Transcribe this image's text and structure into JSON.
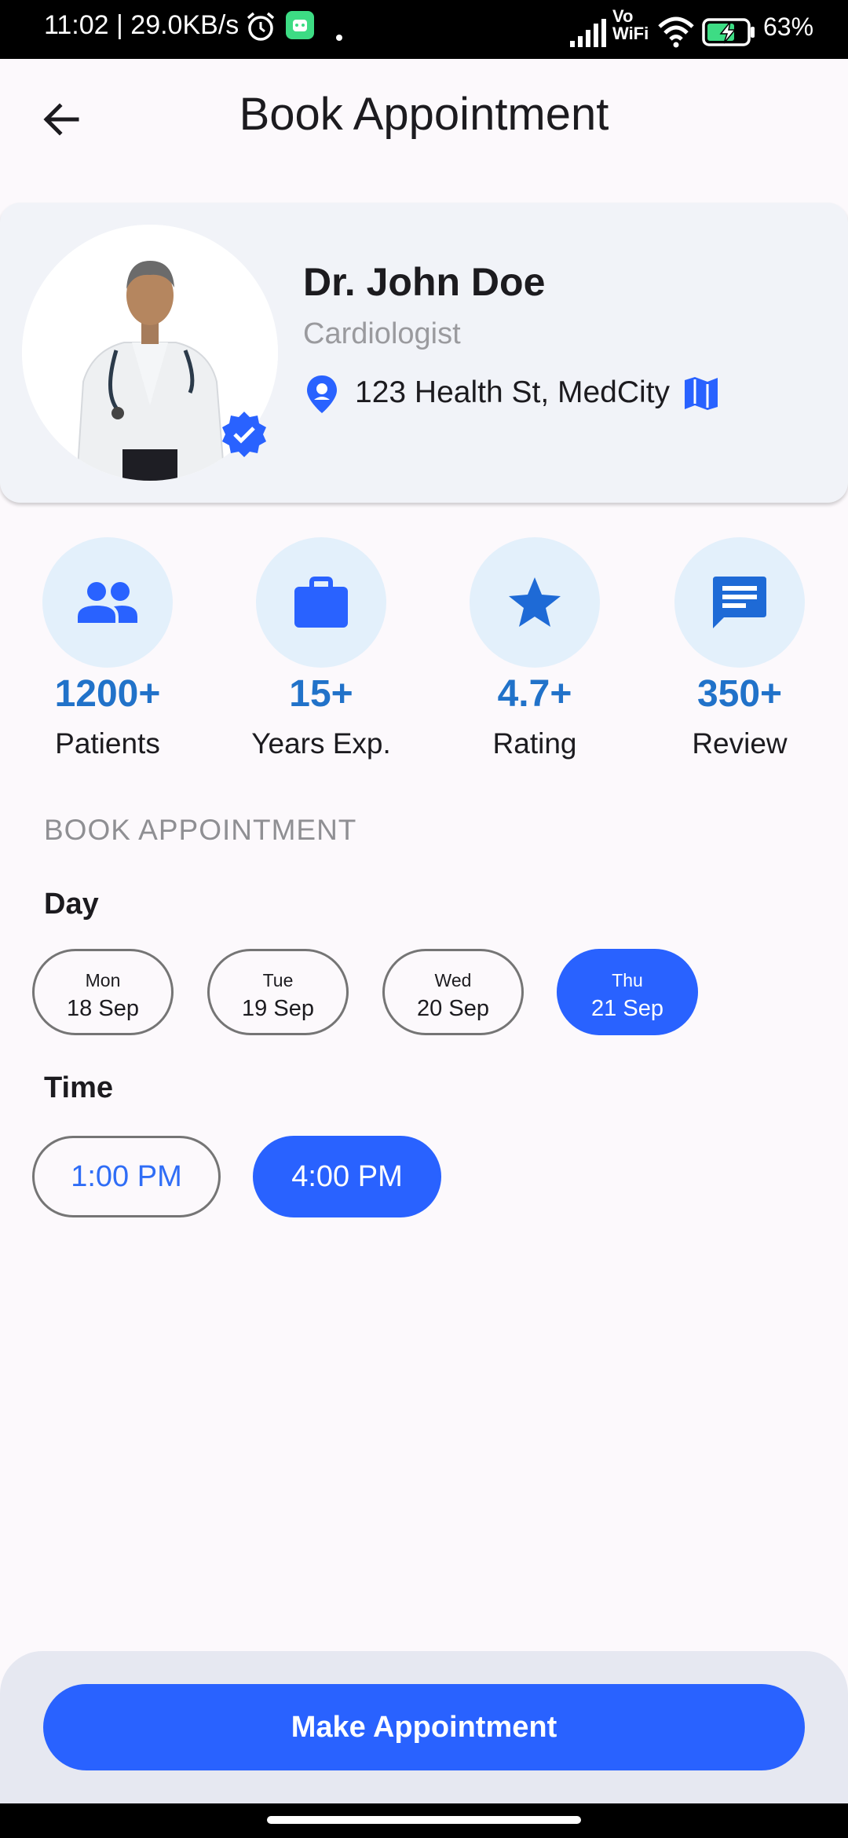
{
  "status_bar": {
    "time_speed": "11:02 | 29.0KB/s",
    "vowifi": "Vo WiFi",
    "battery": "63%",
    "icons": [
      "alarm-icon",
      "app-notification-icon",
      "signal-icon",
      "wifi-icon",
      "battery-charging-icon"
    ]
  },
  "app_bar": {
    "title": "Book Appointment",
    "back_icon": "arrow-back-icon"
  },
  "doctor": {
    "name": "Dr. John Doe",
    "specialty": "Cardiologist",
    "address": "123 Health St, MedCity",
    "verified_icon": "verified-badge-icon",
    "location_icon": "location-pin-icon",
    "map_icon": "map-icon"
  },
  "stats": [
    {
      "value": "1200+",
      "label": "Patients",
      "icon": "people-icon"
    },
    {
      "value": "15+",
      "label": "Years Exp.",
      "icon": "briefcase-icon"
    },
    {
      "value": "4.7+",
      "label": "Rating",
      "icon": "star-icon"
    },
    {
      "value": "350+",
      "label": "Review",
      "icon": "chat-icon"
    }
  ],
  "booking": {
    "section_title": "BOOK APPOINTMENT",
    "day_label": "Day",
    "time_label": "Time",
    "days": [
      {
        "name": "Mon",
        "date": "18 Sep",
        "selected": false
      },
      {
        "name": "Tue",
        "date": "19 Sep",
        "selected": false
      },
      {
        "name": "Wed",
        "date": "20 Sep",
        "selected": false
      },
      {
        "name": "Thu",
        "date": "21 Sep",
        "selected": true
      }
    ],
    "times": [
      {
        "label": "1:00 PM",
        "selected": false
      },
      {
        "label": "4:00 PM",
        "selected": true
      }
    ]
  },
  "cta": {
    "label": "Make Appointment"
  },
  "colors": {
    "primary": "#2962ff",
    "stat_value": "#2172c9",
    "stat_circle": "#e3f0fb",
    "card_bg": "#f1f3f8",
    "page_bg": "#fcf9fc"
  }
}
